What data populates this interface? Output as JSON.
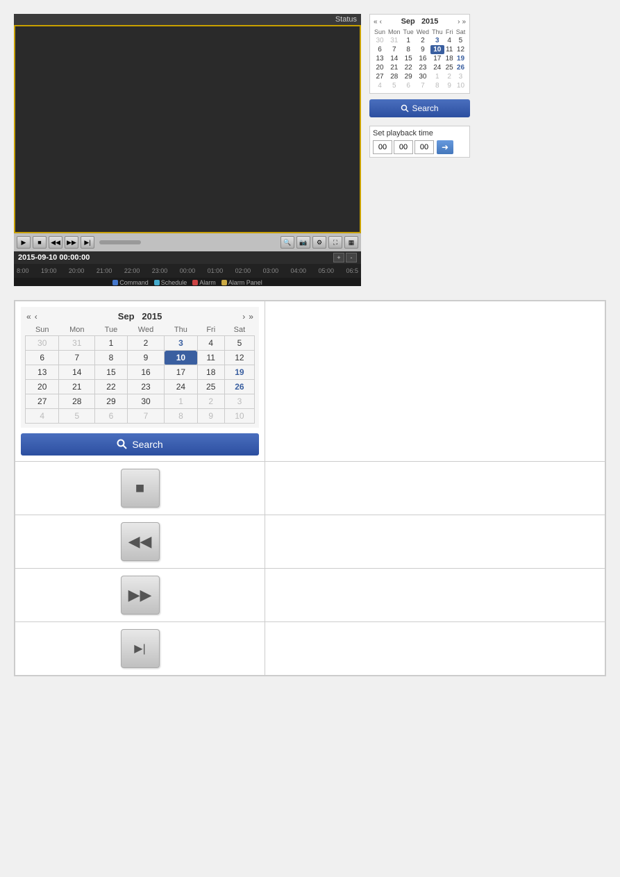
{
  "top": {
    "video": {
      "status_label": "Status",
      "date_time": "2015-09-10 00:00:00",
      "timeline_marks": [
        "8:00",
        "19:00",
        "20:00",
        "21:00",
        "22:00",
        "23:00",
        "00:00",
        "01:00",
        "02:00",
        "03:00",
        "04:00",
        "05:00",
        "06:5"
      ],
      "legend": [
        {
          "label": "Command",
          "color": "#4477cc"
        },
        {
          "label": "Schedule",
          "color": "#44aacc"
        },
        {
          "label": "Alarm",
          "color": "#cc4444"
        },
        {
          "label": "Alarm Panel",
          "color": "#ccaa44"
        }
      ]
    },
    "calendar": {
      "month": "Sep",
      "year": "2015",
      "days_header": [
        "Sun",
        "Mon",
        "Tue",
        "Wed",
        "Thu",
        "Fri",
        "Sat"
      ],
      "weeks": [
        [
          {
            "d": "30",
            "m": "other"
          },
          {
            "d": "31",
            "m": "other"
          },
          {
            "d": "1"
          },
          {
            "d": "2"
          },
          {
            "d": "3",
            "m": "has-data"
          },
          {
            "d": "4"
          },
          {
            "d": "5"
          }
        ],
        [
          {
            "d": "6"
          },
          {
            "d": "7"
          },
          {
            "d": "8"
          },
          {
            "d": "9"
          },
          {
            "d": "10",
            "m": "today"
          },
          {
            "d": "11"
          },
          {
            "d": "12"
          }
        ],
        [
          {
            "d": "13"
          },
          {
            "d": "14"
          },
          {
            "d": "15"
          },
          {
            "d": "16"
          },
          {
            "d": "17"
          },
          {
            "d": "18"
          },
          {
            "d": "19",
            "m": "has-data"
          }
        ],
        [
          {
            "d": "20"
          },
          {
            "d": "21"
          },
          {
            "d": "22"
          },
          {
            "d": "23"
          },
          {
            "d": "24"
          },
          {
            "d": "25"
          },
          {
            "d": "26",
            "m": "has-data"
          }
        ],
        [
          {
            "d": "27"
          },
          {
            "d": "28"
          },
          {
            "d": "29"
          },
          {
            "d": "30"
          },
          {
            "d": "1",
            "m": "other"
          },
          {
            "d": "2",
            "m": "other"
          },
          {
            "d": "3",
            "m": "other"
          }
        ],
        [
          {
            "d": "4",
            "m": "other"
          },
          {
            "d": "5",
            "m": "other"
          },
          {
            "d": "6",
            "m": "other"
          },
          {
            "d": "7",
            "m": "other"
          },
          {
            "d": "8",
            "m": "other"
          },
          {
            "d": "9",
            "m": "other"
          },
          {
            "d": "10",
            "m": "other"
          }
        ]
      ],
      "search_btn": "Search"
    },
    "playback_time": {
      "label": "Set playback time",
      "h": "00",
      "m": "00",
      "s": "00"
    }
  },
  "bottom": {
    "calendar": {
      "month": "Sep",
      "year": "2015",
      "days_header": [
        "Sun",
        "Mon",
        "Tue",
        "Wed",
        "Thu",
        "Fri",
        "Sat"
      ],
      "weeks": [
        [
          {
            "d": "30",
            "m": "other"
          },
          {
            "d": "31",
            "m": "other"
          },
          {
            "d": "1"
          },
          {
            "d": "2"
          },
          {
            "d": "3",
            "m": "has-data"
          },
          {
            "d": "4"
          },
          {
            "d": "5"
          }
        ],
        [
          {
            "d": "6"
          },
          {
            "d": "7"
          },
          {
            "d": "8"
          },
          {
            "d": "9"
          },
          {
            "d": "10",
            "m": "today"
          },
          {
            "d": "11"
          },
          {
            "d": "12"
          }
        ],
        [
          {
            "d": "13"
          },
          {
            "d": "14"
          },
          {
            "d": "15"
          },
          {
            "d": "16"
          },
          {
            "d": "17"
          },
          {
            "d": "18"
          },
          {
            "d": "19",
            "m": "has-data"
          }
        ],
        [
          {
            "d": "20"
          },
          {
            "d": "21"
          },
          {
            "d": "22"
          },
          {
            "d": "23"
          },
          {
            "d": "24"
          },
          {
            "d": "25"
          },
          {
            "d": "26",
            "m": "has-data"
          }
        ],
        [
          {
            "d": "27"
          },
          {
            "d": "28"
          },
          {
            "d": "29"
          },
          {
            "d": "30"
          },
          {
            "d": "1",
            "m": "other"
          },
          {
            "d": "2",
            "m": "other"
          },
          {
            "d": "3",
            "m": "other"
          }
        ],
        [
          {
            "d": "4",
            "m": "other"
          },
          {
            "d": "5",
            "m": "other"
          },
          {
            "d": "6",
            "m": "other"
          },
          {
            "d": "7",
            "m": "other"
          },
          {
            "d": "8",
            "m": "other"
          },
          {
            "d": "9",
            "m": "other"
          },
          {
            "d": "10",
            "m": "other"
          }
        ]
      ],
      "search_btn": "Search"
    },
    "playback_buttons": [
      {
        "name": "stop-button",
        "symbol": "■",
        "label": "Stop"
      },
      {
        "name": "rewind-button",
        "symbol": "◀◀",
        "label": "Rewind"
      },
      {
        "name": "fast-forward-button",
        "symbol": "▶▶",
        "label": "Fast Forward"
      },
      {
        "name": "step-forward-button",
        "symbol": "▶|",
        "label": "Step Forward"
      }
    ]
  }
}
